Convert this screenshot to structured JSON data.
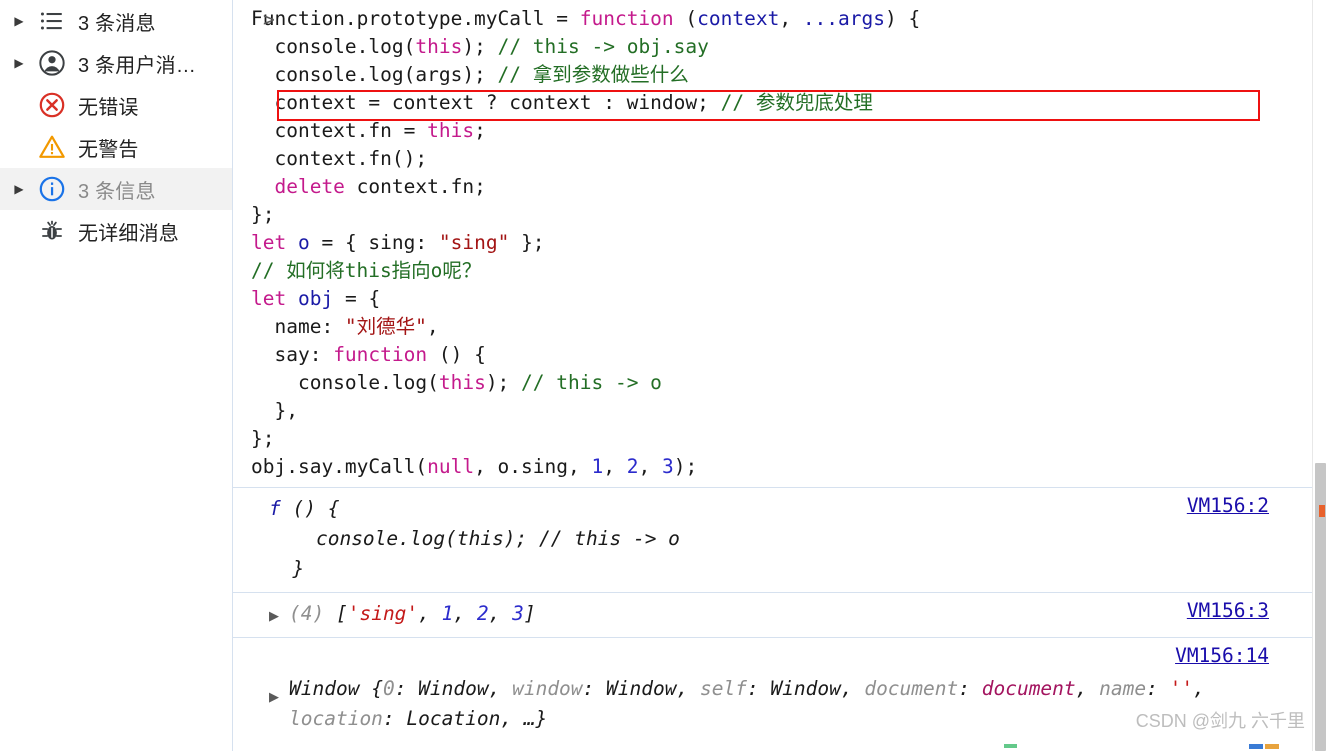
{
  "sidebar": {
    "items": [
      {
        "label": "3 条消息",
        "icon": "list-icon",
        "twisty": true,
        "selected": false
      },
      {
        "label": "3 条用户消…",
        "icon": "user-icon",
        "twisty": true,
        "selected": false
      },
      {
        "label": "无错误",
        "icon": "error-icon",
        "twisty": false,
        "selected": false
      },
      {
        "label": "无警告",
        "icon": "warning-icon",
        "twisty": false,
        "selected": false
      },
      {
        "label": "3 条信息",
        "icon": "info-icon",
        "twisty": true,
        "selected": true
      },
      {
        "label": "无详细消息",
        "icon": "verbose-icon",
        "twisty": false,
        "selected": false
      }
    ]
  },
  "console": {
    "prompt_caret": ">",
    "input_lines": [
      [
        {
          "t": "Function.prototype.myCall = ",
          "c": "plain"
        },
        {
          "t": "function",
          "c": "fn"
        },
        {
          "t": " (",
          "c": "plain"
        },
        {
          "t": "context",
          "c": "param"
        },
        {
          "t": ", ",
          "c": "plain"
        },
        {
          "t": "...args",
          "c": "param"
        },
        {
          "t": ") {",
          "c": "plain"
        }
      ],
      [
        {
          "t": "  console.log(",
          "c": "plain"
        },
        {
          "t": "this",
          "c": "this"
        },
        {
          "t": "); ",
          "c": "plain"
        },
        {
          "t": "// this -> obj.say",
          "c": "cmt"
        }
      ],
      [
        {
          "t": "  console.log(args); ",
          "c": "plain"
        },
        {
          "t": "// 拿到参数做些什么",
          "c": "cmt"
        }
      ],
      [
        {
          "t": "  context = context ? context : window; ",
          "c": "plain"
        },
        {
          "t": "// 参数兜底处理",
          "c": "cmt"
        }
      ],
      [
        {
          "t": "  context.fn = ",
          "c": "plain"
        },
        {
          "t": "this",
          "c": "this"
        },
        {
          "t": ";",
          "c": "plain"
        }
      ],
      [
        {
          "t": "  context.fn();",
          "c": "plain"
        }
      ],
      [
        {
          "t": "  ",
          "c": "plain"
        },
        {
          "t": "delete",
          "c": "kw"
        },
        {
          "t": " context.fn;",
          "c": "plain"
        }
      ],
      [
        {
          "t": "};",
          "c": "plain"
        }
      ],
      [
        {
          "t": "let",
          "c": "kw"
        },
        {
          "t": " ",
          "c": "plain"
        },
        {
          "t": "o",
          "c": "var"
        },
        {
          "t": " = { sing: ",
          "c": "plain"
        },
        {
          "t": "\"sing\"",
          "c": "str"
        },
        {
          "t": " };",
          "c": "plain"
        }
      ],
      [
        {
          "t": "// 如何将this指向o呢？",
          "c": "cmt"
        }
      ],
      [
        {
          "t": "let",
          "c": "kw"
        },
        {
          "t": " ",
          "c": "plain"
        },
        {
          "t": "obj",
          "c": "var"
        },
        {
          "t": " = {",
          "c": "plain"
        }
      ],
      [
        {
          "t": "  name: ",
          "c": "plain"
        },
        {
          "t": "\"刘德华\"",
          "c": "str"
        },
        {
          "t": ",",
          "c": "plain"
        }
      ],
      [
        {
          "t": "  say: ",
          "c": "plain"
        },
        {
          "t": "function",
          "c": "fn"
        },
        {
          "t": " () {",
          "c": "plain"
        }
      ],
      [
        {
          "t": "    console.log(",
          "c": "plain"
        },
        {
          "t": "this",
          "c": "this"
        },
        {
          "t": "); ",
          "c": "plain"
        },
        {
          "t": "// this -> o",
          "c": "cmt"
        }
      ],
      [
        {
          "t": "  },",
          "c": "plain"
        }
      ],
      [
        {
          "t": "};",
          "c": "plain"
        }
      ],
      [
        {
          "t": "obj.say.myCall(",
          "c": "plain"
        },
        {
          "t": "null",
          "c": "null"
        },
        {
          "t": ", o.sing, ",
          "c": "plain"
        },
        {
          "t": "1",
          "c": "num"
        },
        {
          "t": ", ",
          "c": "plain"
        },
        {
          "t": "2",
          "c": "num"
        },
        {
          "t": ", ",
          "c": "plain"
        },
        {
          "t": "3",
          "c": "num"
        },
        {
          "t": ");",
          "c": "plain"
        }
      ]
    ],
    "outputs": [
      {
        "arrow": false,
        "link": "VM156:2",
        "parts": [
          {
            "t": "f",
            "c": "f"
          },
          {
            "t": " () {\n    console.log(this); // this -> o\n  }",
            "c": "plain"
          }
        ]
      },
      {
        "arrow": true,
        "link": "VM156:3",
        "parts": [
          {
            "t": "(4) ",
            "c": "gray"
          },
          {
            "t": "[",
            "c": "plain"
          },
          {
            "t": "'sing'",
            "c": "str"
          },
          {
            "t": ", ",
            "c": "plain"
          },
          {
            "t": "1",
            "c": "num"
          },
          {
            "t": ", ",
            "c": "plain"
          },
          {
            "t": "2",
            "c": "num"
          },
          {
            "t": ", ",
            "c": "plain"
          },
          {
            "t": "3",
            "c": "num"
          },
          {
            "t": "]",
            "c": "plain"
          }
        ]
      },
      {
        "arrow": true,
        "link": "VM156:14",
        "parts": [
          {
            "t": "Window ",
            "c": "plain"
          },
          {
            "t": "{",
            "c": "plain"
          },
          {
            "t": "0",
            "c": "gray"
          },
          {
            "t": ": Window, ",
            "c": "plain"
          },
          {
            "t": "window",
            "c": "gray"
          },
          {
            "t": ": Window, ",
            "c": "plain"
          },
          {
            "t": "self",
            "c": "gray"
          },
          {
            "t": ": Window, ",
            "c": "plain"
          },
          {
            "t": "document",
            "c": "gray"
          },
          {
            "t": ": ",
            "c": "plain"
          },
          {
            "t": "document",
            "c": "doc"
          },
          {
            "t": ", ",
            "c": "plain"
          },
          {
            "t": "name",
            "c": "gray"
          },
          {
            "t": ": ",
            "c": "plain"
          },
          {
            "t": "''",
            "c": "str"
          },
          {
            "t": ", ",
            "c": "plain"
          },
          {
            "t": "location",
            "c": "gray"
          },
          {
            "t": ": Location, …}",
            "c": "plain"
          }
        ]
      }
    ]
  },
  "watermark": "CSDN @剑九 六千里",
  "colors": {
    "accent_link": "#1a0dab",
    "error": "#d93025",
    "warning": "#f29900",
    "info": "#1a73e8",
    "annotation_box": "#ee1111",
    "divider": "#d6e1ef",
    "selected_row": "#f2f2f2"
  }
}
